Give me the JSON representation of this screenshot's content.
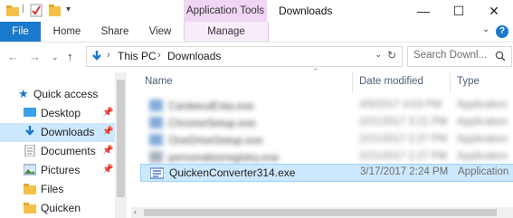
{
  "window": {
    "title": "Downloads",
    "context_tab": "Application Tools",
    "controls": {
      "minimize": "—",
      "maximize": "☐",
      "close": "✕"
    }
  },
  "ribbon": {
    "tabs": [
      "File",
      "Home",
      "Share",
      "View",
      "Manage"
    ],
    "help": "?",
    "expand": "⌄"
  },
  "address": {
    "path": [
      "This PC",
      "Downloads"
    ],
    "separator": "›",
    "search_placeholder": "Search Downl..."
  },
  "nav_pane": {
    "items": [
      {
        "label": "Quick access",
        "icon": "star-icon",
        "pinned": false
      },
      {
        "label": "Desktop",
        "icon": "desktop-folder-icon",
        "pinned": true
      },
      {
        "label": "Downloads",
        "icon": "download-arrow-icon",
        "pinned": true,
        "selected": true
      },
      {
        "label": "Documents",
        "icon": "documents-icon",
        "pinned": true
      },
      {
        "label": "Pictures",
        "icon": "pictures-icon",
        "pinned": true
      },
      {
        "label": "Files",
        "icon": "folder-icon",
        "pinned": false
      },
      {
        "label": "Quicken",
        "icon": "folder-icon",
        "pinned": false
      }
    ]
  },
  "file_list": {
    "columns": [
      "Name",
      "Date modified",
      "Type"
    ],
    "rows": [
      {
        "name": "CanteeuiEsta.exe",
        "date": "4/5/2017 4:53 PM",
        "type": "Application",
        "blurred": true
      },
      {
        "name": "ChromeSetup.exe",
        "date": "2/21/2017 3:21 PM",
        "type": "Application",
        "blurred": true
      },
      {
        "name": "OneDriveSetup.exe",
        "date": "2/21/2017 2:27 PM",
        "type": "Application",
        "blurred": true
      },
      {
        "name": "personalizeregistry.exe",
        "date": "2/21/2017 2:27 PM",
        "type": "Application",
        "blurred": true
      },
      {
        "name": "QuickenConverter314.exe",
        "date": "3/17/2017 2:24 PM",
        "type": "Application",
        "blurred": false,
        "selected": true
      }
    ]
  },
  "colors": {
    "accent": "#1979ca",
    "context_tab": "#f0d6f4",
    "selection": "#cce8ff"
  }
}
